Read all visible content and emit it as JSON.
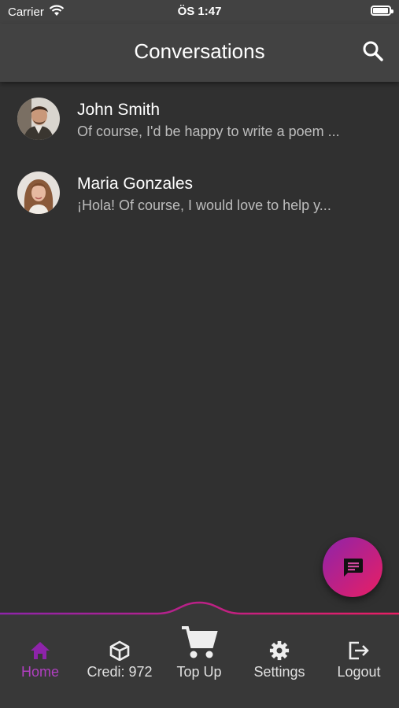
{
  "status": {
    "carrier": "Carrier",
    "time": "ÖS 1:47"
  },
  "appbar": {
    "title": "Conversations"
  },
  "conversations": [
    {
      "name": "John Smith",
      "preview": "Of course, I'd be happy to write a poem ..."
    },
    {
      "name": "Maria Gonzales",
      "preview": "¡Hola! Of course, I would love to help y..."
    }
  ],
  "nav": {
    "home": "Home",
    "credits": "Credi: 972",
    "topup": "Top Up",
    "settings": "Settings",
    "logout": "Logout"
  },
  "colors": {
    "accent": "#b03fc0",
    "gradient_start": "#8e24aa",
    "gradient_end": "#e91e63",
    "background": "#303030",
    "appbar": "#424242"
  },
  "icons": {
    "search": "search-icon",
    "fab": "chat-icon",
    "home": "home-icon",
    "credits": "cube-icon",
    "topup": "cart-icon",
    "settings": "gear-icon",
    "logout": "logout-icon"
  }
}
